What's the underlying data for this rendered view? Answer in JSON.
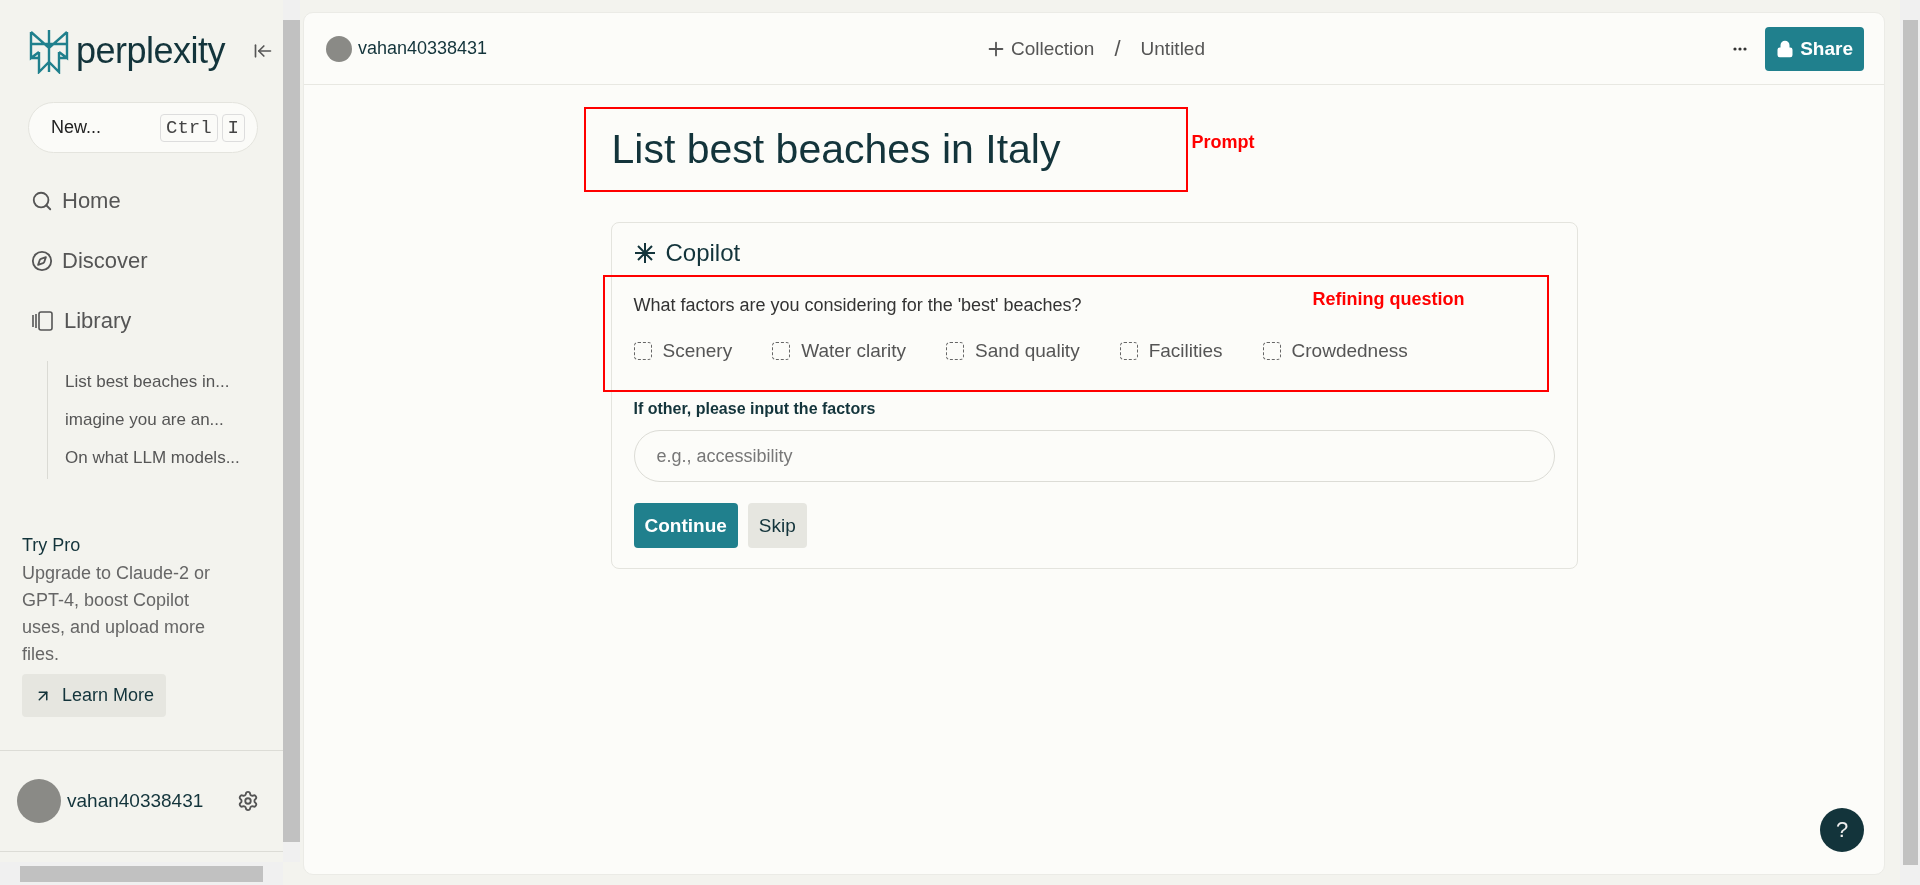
{
  "sidebar": {
    "brand": "perplexity",
    "new_thread": {
      "label": "New...",
      "keys": [
        "Ctrl",
        "I"
      ]
    },
    "nav": [
      {
        "label": "Home"
      },
      {
        "label": "Discover"
      },
      {
        "label": "Library"
      }
    ],
    "library": [
      "List best beaches in...",
      "imagine you are an...",
      "On what LLM models..."
    ],
    "promo": {
      "title": "Try Pro",
      "text": "Upgrade to Claude-2 or GPT-4, boost Copilot uses, and upload more files.",
      "button": "Learn More"
    },
    "user": {
      "name": "vahan40338431"
    }
  },
  "header": {
    "user": "vahan40338431",
    "collection": "Collection",
    "separator": "/",
    "title": "Untitled",
    "share": "Share"
  },
  "query": {
    "title": "List best beaches in Italy",
    "annotation": "Prompt"
  },
  "copilot": {
    "title": "Copilot",
    "annotation": "Refining question",
    "question": "What factors are you considering for the 'best' beaches?",
    "options": [
      {
        "label": "Scenery",
        "checked": false
      },
      {
        "label": "Water clarity",
        "checked": false
      },
      {
        "label": "Sand quality",
        "checked": false
      },
      {
        "label": "Facilities",
        "checked": false
      },
      {
        "label": "Crowdedness",
        "checked": false
      }
    ],
    "other_label": "If other, please input the factors",
    "input": {
      "placeholder": "e.g., accessibility"
    },
    "buttons": [
      {
        "label": "Continue",
        "kind": "primary"
      },
      {
        "label": "Skip",
        "kind": "secondary"
      }
    ]
  },
  "help": "?"
}
